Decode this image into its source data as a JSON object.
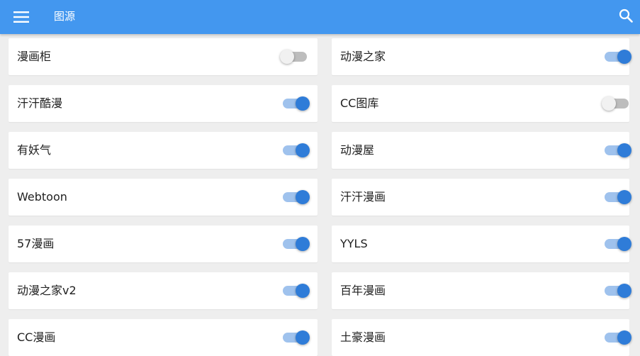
{
  "appbar": {
    "title": "图源",
    "menu_icon": "hamburger-menu-icon",
    "search_icon": "search-icon",
    "bg_color": "#4397ef"
  },
  "sources": [
    {
      "name": "漫画柜",
      "enabled": false
    },
    {
      "name": "动漫之家",
      "enabled": true
    },
    {
      "name": "汗汗酷漫",
      "enabled": true
    },
    {
      "name": "CC图库",
      "enabled": false
    },
    {
      "name": "有妖气",
      "enabled": true
    },
    {
      "name": "动漫屋",
      "enabled": true
    },
    {
      "name": "Webtoon",
      "enabled": true
    },
    {
      "name": "汗汗漫画",
      "enabled": true
    },
    {
      "name": "57漫画",
      "enabled": true
    },
    {
      "name": "YYLS",
      "enabled": true
    },
    {
      "name": "动漫之家v2",
      "enabled": true
    },
    {
      "name": "百年漫画",
      "enabled": true
    },
    {
      "name": "CC漫画",
      "enabled": true
    },
    {
      "name": "土豪漫画",
      "enabled": true
    }
  ],
  "colors": {
    "switch_on_thumb": "#2f7cd8",
    "switch_on_track": "#9fc2ed",
    "switch_off_thumb": "#f1f1f1",
    "switch_off_track": "#bdbdbd"
  }
}
